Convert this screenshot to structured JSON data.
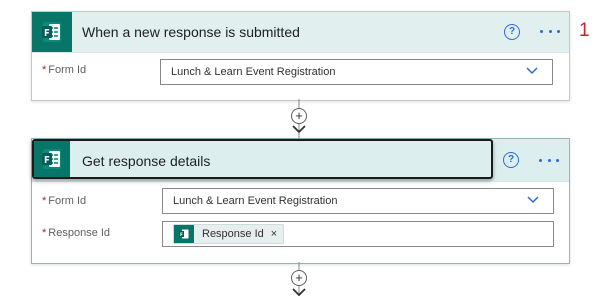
{
  "steps": [
    {
      "title": "When a new response is submitted",
      "step_number": "1",
      "fields": [
        {
          "required_mark": "*",
          "label": "Form Id",
          "value": "Lunch & Learn Event Registration"
        }
      ]
    },
    {
      "title": "Get response details",
      "fields": [
        {
          "required_mark": "*",
          "label": "Form Id",
          "value": "Lunch & Learn Event Registration"
        },
        {
          "required_mark": "*",
          "label": "Response Id",
          "token": "Response Id",
          "token_close": "×"
        }
      ]
    }
  ],
  "icons": {
    "app": "microsoft-forms-icon",
    "help": "help-icon",
    "more": "more-options-icon",
    "dropdown": "chevron-down-icon",
    "add": "add-step-icon",
    "arrow": "arrow-down-icon"
  },
  "glyphs": {
    "help": "?",
    "add": "+"
  },
  "colors": {
    "forms_green": "#077568",
    "header_bg": "#e1efef",
    "accent_blue": "#2c6bd6",
    "step_number_red": "#d11f2a",
    "required_red": "#a4262c"
  }
}
